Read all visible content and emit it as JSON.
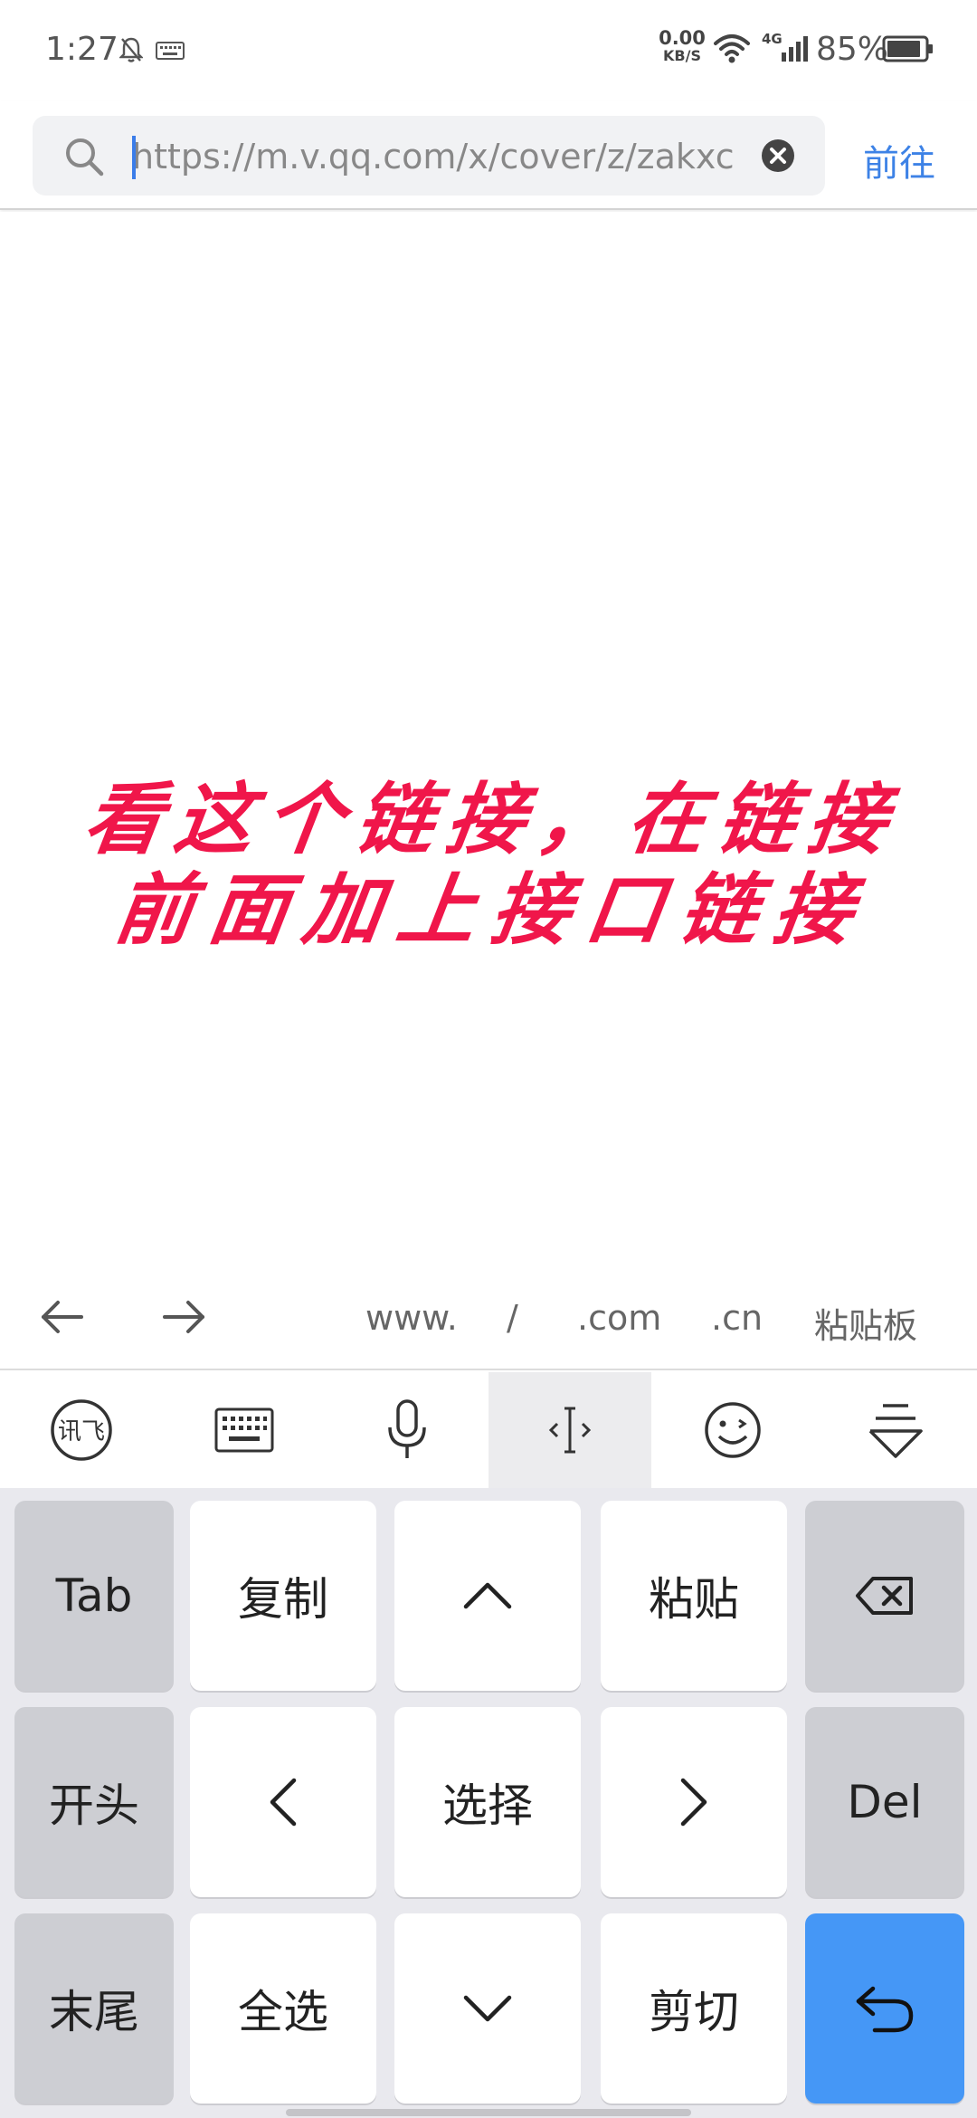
{
  "status_bar": {
    "time": "1:27",
    "net_speed_value": "0.00",
    "net_speed_unit": "KB/S",
    "network_type": "4G",
    "battery_percent": "85%"
  },
  "address_bar": {
    "url": "https://m.v.qq.com/x/cover/z/zakxc",
    "go_label": "前往"
  },
  "page": {
    "note_line1": "看这个链接，在链接",
    "note_line2": "前面加上接口链接"
  },
  "suggestions": {
    "items": [
      "www.",
      "/",
      ".com",
      ".cn",
      "粘贴板"
    ]
  },
  "keyboard_toolbar": {
    "icons": [
      "ifly-logo-icon",
      "keyboard-icon",
      "microphone-icon",
      "cursor-move-icon",
      "emoji-icon",
      "collapse-keyboard-icon"
    ]
  },
  "keyboard": {
    "keys": {
      "tab": "Tab",
      "copy": "复制",
      "paste": "粘贴",
      "home": "开头",
      "select": "选择",
      "del": "Del",
      "end": "末尾",
      "select_all": "全选",
      "cut": "剪切"
    }
  },
  "colors": {
    "accent": "#3d82e6",
    "note_red": "#f0164a",
    "enter_key": "#4597f6"
  }
}
